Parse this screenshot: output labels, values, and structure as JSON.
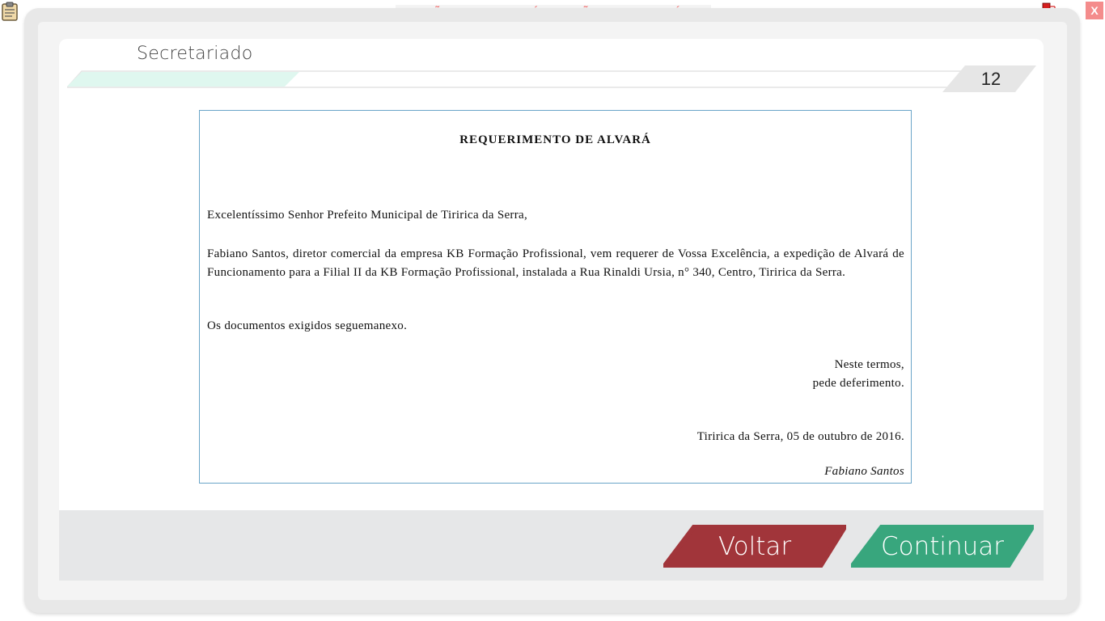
{
  "header": {
    "banner_text": "VERSÃO PARA FUNCIONÁRIOS - NÃO COMERCIALIZÁVEL",
    "close_label": "X",
    "icons": [
      "clipboard-icon",
      "network-icon"
    ]
  },
  "page": {
    "title": "Secretariado",
    "number": "12"
  },
  "document": {
    "title": "REQUERIMENTO DE ALVARÁ",
    "salutation": "Excelentíssimo Senhor Prefeito Municipal de Tiririca da Serra,",
    "body": "Fabiano Santos, diretor comercial da empresa KB Formação Profissional, vem requerer de Vossa Excelência, a expedição de Alvará de Funcionamento para a Filial II da KB Formação Profissional, instalada a Rua Rinaldi Ursia, n° 340, Centro, Tiririca da Serra.",
    "attachments": "Os documentos exigidos seguemanexo.",
    "closing_line1": "Neste termos,",
    "closing_line2": "pede deferimento.",
    "date": "Tiririca da Serra, 05 de outubro de 2016.",
    "signature": "Fabiano Santos"
  },
  "footer": {
    "back_label": "Voltar",
    "continue_label": "Continuar"
  },
  "colors": {
    "back_button": "#a1353a",
    "continue_button": "#38a67d",
    "progress_fill": "#dff7ef",
    "banner_text": "#f26b6b",
    "document_border": "#6aa5c8"
  }
}
